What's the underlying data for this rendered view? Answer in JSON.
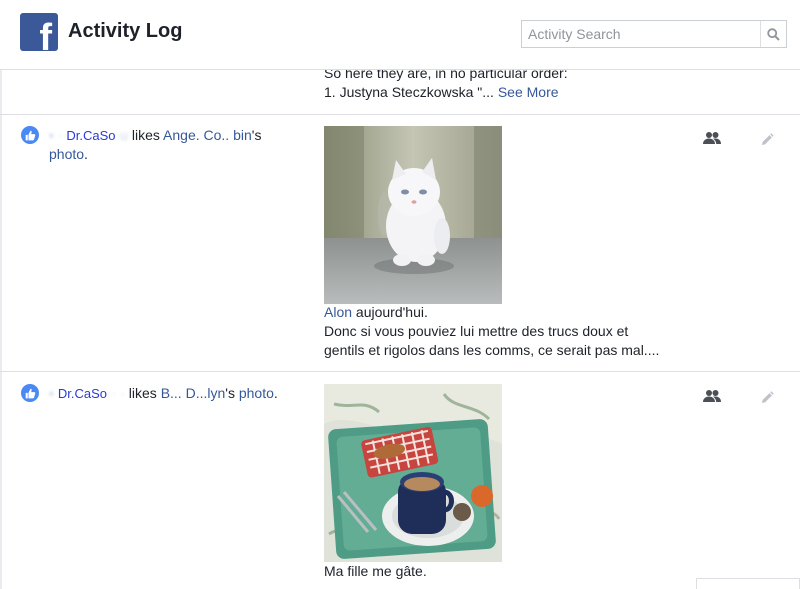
{
  "header": {
    "logo_letter": "f",
    "title": "Activity Log",
    "search_placeholder": "Activity Search"
  },
  "previous_entry": {
    "line1": "So here they are, in no particular order:",
    "line2": "1. Justyna Steczkowska \"...",
    "see_more": "See More"
  },
  "entries": [
    {
      "user": "Dr.CaSo",
      "verb": "likes",
      "owner": "Ange. Co.. bin",
      "suffix": "'s",
      "object": "photo",
      "period": ".",
      "caption_link": "Alon",
      "caption_line1_rest": " aujourd'hui.",
      "caption_line2": "Donc si vous pouviez lui mettre des trucs doux et",
      "caption_line3": "gentils et rigolos dans les comms, ce serait pas mal....",
      "image": "white-kitten-photo",
      "audience_icon": "friends-icon",
      "edit_icon": "pencil-icon"
    },
    {
      "user": "Dr.CaSo",
      "verb": "likes",
      "owner": "B... D...lyn",
      "suffix": "'s",
      "object": "photo",
      "period": ".",
      "caption_line1": "Ma fille me gâte.",
      "image": "breakfast-tray-photo",
      "audience_icon": "friends-icon",
      "edit_icon": "pencil-icon"
    }
  ],
  "colors": {
    "brand": "#3b5998",
    "link": "#365899",
    "like_icon": "#4a89f3",
    "divider": "#dddfe2",
    "icon_gray": "#90949c"
  }
}
